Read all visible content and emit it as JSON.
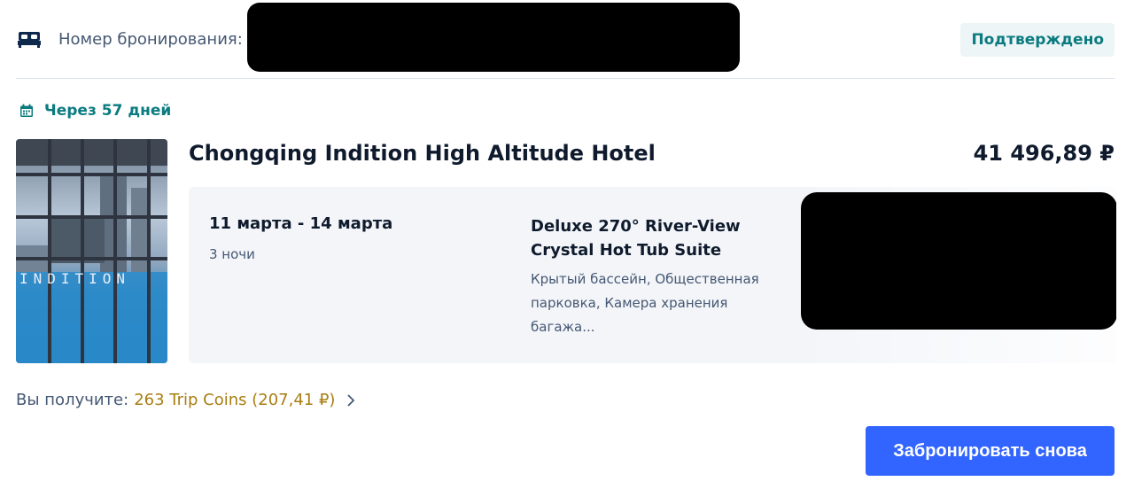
{
  "header": {
    "booking_label": "Номер бронирования:",
    "status": "Подтверждено",
    "status_color": "#0b7b80"
  },
  "trip": {
    "countdown": "Через 57 дней"
  },
  "hotel": {
    "name": "Chongqing Indition High Altitude Hotel",
    "price": "41 496,89 ₽",
    "photo_overlay_text": "INDITION"
  },
  "stay": {
    "dates": "11 марта - 14 марта",
    "nights": "3 ночи",
    "room_name": "Deluxe 270° River-View Crystal Hot Tub Suite",
    "amenities": "Крытый бассейн, Общественная парковка, Камера хранения багажа..."
  },
  "rewards": {
    "label": "Вы получите:",
    "value": "263 Trip Coins (207,41 ₽)",
    "value_color": "#a87e12"
  },
  "actions": {
    "rebook_label": "Забронировать снова",
    "rebook_color": "#3264ff"
  },
  "icons": {
    "bed": "bed-icon",
    "calendar": "calendar-icon",
    "chevron": "chevron-right-icon"
  }
}
